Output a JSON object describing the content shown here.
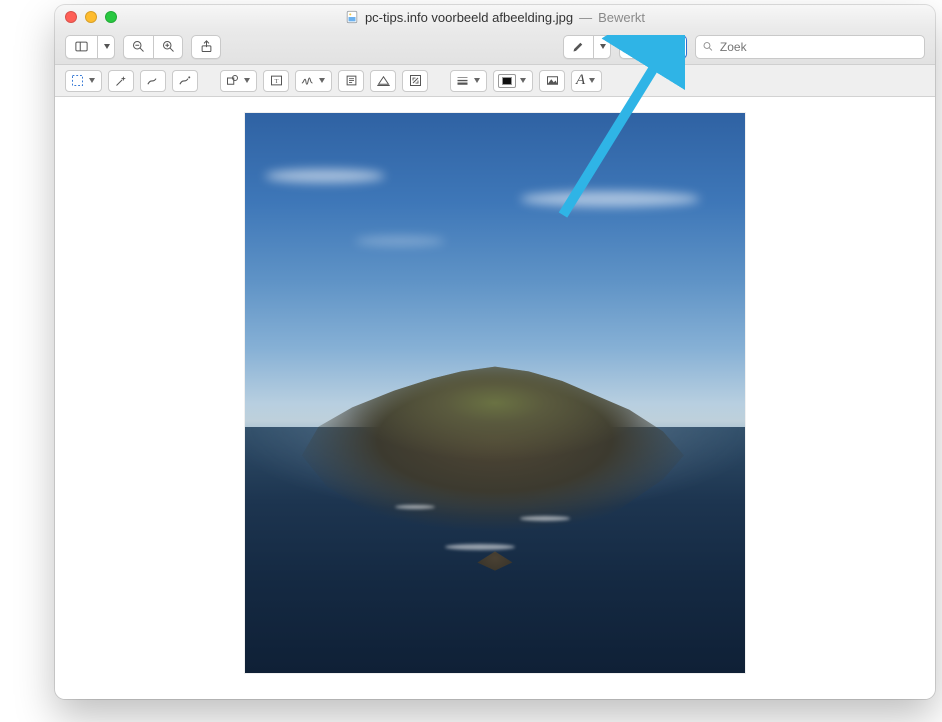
{
  "title": {
    "filename": "pc-tips.info voorbeeld afbeelding.jpg",
    "separator": "—",
    "status": "Bewerkt"
  },
  "toolbar": {
    "search_placeholder": "Zoek"
  },
  "markup": {
    "text_style_glyph": "A"
  },
  "colors": {
    "markup_active": "#1768d4",
    "annotation_arrow": "#2fb4e6"
  }
}
